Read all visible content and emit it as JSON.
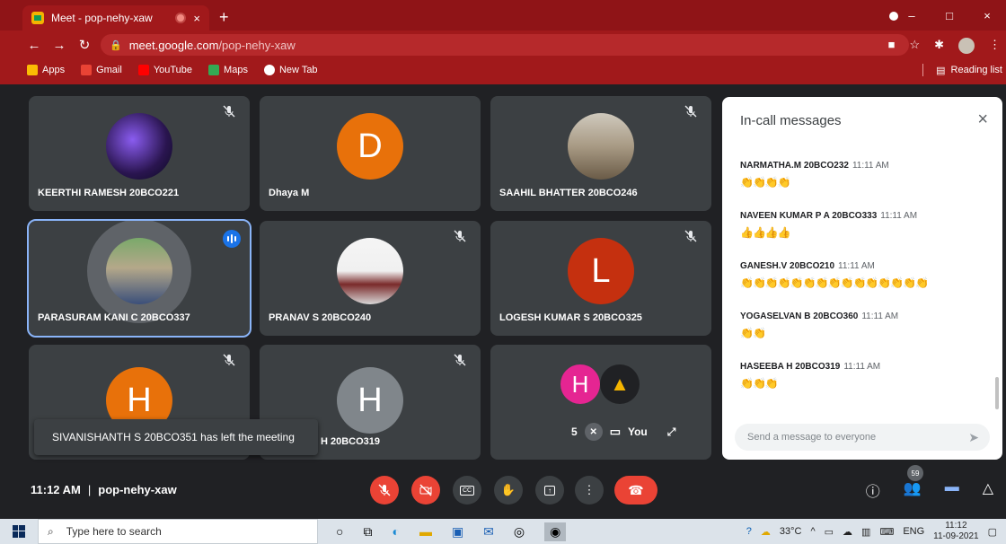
{
  "browser": {
    "tab_title": "Meet - pop-nehy-xaw",
    "tab_close": "×",
    "new_tab": "+",
    "url_host": "meet.google.com",
    "url_path": "/pop-nehy-xaw",
    "win_min": "–",
    "win_max": "□",
    "win_close": "×",
    "bookmarks": [
      {
        "label": "Apps",
        "color": "#fbbc04"
      },
      {
        "label": "Gmail",
        "color": "#ea4335"
      },
      {
        "label": "YouTube",
        "color": "#ff0000"
      },
      {
        "label": "Maps",
        "color": "#34a853"
      },
      {
        "label": "New Tab",
        "color": "#ffffff"
      }
    ],
    "reading_list": "Reading list"
  },
  "tiles": [
    {
      "name": "KEERTHI RAMESH 20BCO221",
      "avatar": "photo"
    },
    {
      "name": "Dhaya M",
      "letter": "D",
      "color": "#e8710a"
    },
    {
      "name": "SAAHIL BHATTER 20BCO246",
      "avatar": "photo"
    },
    {
      "name": "PARASURAM KANI C 20BCO337",
      "avatar": "photo",
      "speaking": true
    },
    {
      "name": "PRANAV S 20BCO240",
      "avatar": "photo"
    },
    {
      "name": "LOGESH KUMAR S 20BCO325",
      "letter": "L",
      "color": "#c5300f"
    },
    {
      "name": "",
      "letter": "H",
      "color": "#e8710a"
    },
    {
      "name": "H 20BCO319",
      "letter": "H",
      "color": "#80868b"
    },
    {
      "name": "",
      "letter": "H",
      "color": "#e52592"
    }
  ],
  "toast": "SIVANISHANTH S 20BCO351 has left the meeting",
  "you_tile": {
    "count": "5",
    "label": "You"
  },
  "chat": {
    "title": "In-call messages",
    "close": "×",
    "messages": [
      {
        "sender": "NARMATHA.M 20BCO232",
        "time": "11:11 AM",
        "text": "👏👏👏👏"
      },
      {
        "sender": "NAVEEN KUMAR P A 20BCO333",
        "time": "11:11 AM",
        "text": "👍👍👍👍"
      },
      {
        "sender": "GANESH.V 20BCO210",
        "time": "11:11 AM",
        "text": "👏👏👏👏👏👏👏👏👏👏👏👏👏👏👏"
      },
      {
        "sender": "YOGASELVAN B 20BCO360",
        "time": "11:11 AM",
        "text": "👏👏"
      },
      {
        "sender": "HASEEBA H 20BCO319",
        "time": "11:11 AM",
        "text": "👏👏👏"
      }
    ],
    "placeholder": "Send a message to everyone"
  },
  "controls": {
    "time": "11:12 AM",
    "separator": "|",
    "meeting_code": "pop-nehy-xaw",
    "participants_count": "59"
  },
  "taskbar": {
    "search_placeholder": "Type here to search",
    "weather": "33°C",
    "lang": "ENG",
    "clock_time": "11:12",
    "clock_date": "11-09-2021"
  }
}
